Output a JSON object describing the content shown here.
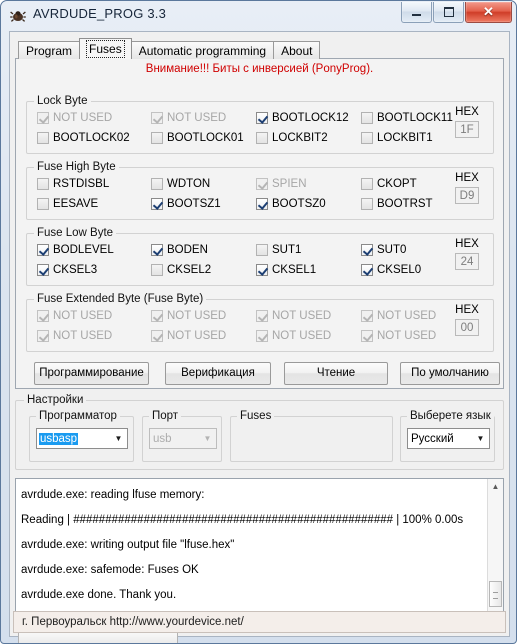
{
  "window": {
    "title": "AVRDUDE_PROG 3.3",
    "icon": "bug-icon",
    "minimize_label": "–",
    "maximize_label": "□",
    "close_label": "✕"
  },
  "tabs": [
    {
      "label": "Program",
      "active": false
    },
    {
      "label": "Fuses",
      "active": true
    },
    {
      "label": "Automatic programming",
      "active": false
    },
    {
      "label": "About",
      "active": false
    }
  ],
  "fuses_page": {
    "warning": "Внимание!!! Биты с инверсией (PonyProg).",
    "warning_color": "#d00000",
    "groups": [
      {
        "legend": "Lock Byte",
        "hex_label": "HEX",
        "hex_value": "1F",
        "bits": [
          {
            "label": "NOT USED",
            "state": "disabled-checked"
          },
          {
            "label": "NOT USED",
            "state": "disabled-checked"
          },
          {
            "label": "BOOTLOCK12",
            "state": "checked"
          },
          {
            "label": "BOOTLOCK11",
            "state": "unchecked"
          },
          {
            "label": "BOOTLOCK02",
            "state": "unchecked"
          },
          {
            "label": "BOOTLOCK01",
            "state": "unchecked"
          },
          {
            "label": "LOCKBIT2",
            "state": "unchecked"
          },
          {
            "label": "LOCKBIT1",
            "state": "unchecked"
          }
        ]
      },
      {
        "legend": "Fuse High Byte",
        "hex_label": "HEX",
        "hex_value": "D9",
        "bits": [
          {
            "label": "RSTDISBL",
            "state": "unchecked"
          },
          {
            "label": "WDTON",
            "state": "unchecked"
          },
          {
            "label": "SPIEN",
            "state": "disabled-checked"
          },
          {
            "label": "CKOPT",
            "state": "unchecked"
          },
          {
            "label": "EESAVE",
            "state": "unchecked"
          },
          {
            "label": "BOOTSZ1",
            "state": "checked"
          },
          {
            "label": "BOOTSZ0",
            "state": "checked"
          },
          {
            "label": "BOOTRST",
            "state": "unchecked"
          }
        ]
      },
      {
        "legend": "Fuse Low Byte",
        "hex_label": "HEX",
        "hex_value": "24",
        "bits": [
          {
            "label": "BODLEVEL",
            "state": "checked"
          },
          {
            "label": "BODEN",
            "state": "checked"
          },
          {
            "label": "SUT1",
            "state": "unchecked"
          },
          {
            "label": "SUT0",
            "state": "checked"
          },
          {
            "label": "CKSEL3",
            "state": "checked"
          },
          {
            "label": "CKSEL2",
            "state": "unchecked"
          },
          {
            "label": "CKSEL1",
            "state": "checked"
          },
          {
            "label": "CKSEL0",
            "state": "checked"
          }
        ]
      },
      {
        "legend": "Fuse Extended Byte (Fuse Byte)",
        "hex_label": "HEX",
        "hex_value": "00",
        "bits": [
          {
            "label": "NOT USED",
            "state": "disabled-checked"
          },
          {
            "label": "NOT USED",
            "state": "disabled-checked"
          },
          {
            "label": "NOT USED",
            "state": "disabled-checked"
          },
          {
            "label": "NOT USED",
            "state": "disabled-checked"
          },
          {
            "label": "NOT USED",
            "state": "disabled-checked"
          },
          {
            "label": "NOT USED",
            "state": "disabled-checked"
          },
          {
            "label": "NOT USED",
            "state": "disabled-checked"
          },
          {
            "label": "NOT USED",
            "state": "disabled-checked"
          }
        ]
      }
    ],
    "actions": [
      {
        "label": "Программирование"
      },
      {
        "label": "Верификация"
      },
      {
        "label": "Чтение"
      },
      {
        "label": "По умолчанию"
      }
    ]
  },
  "settings": {
    "legend": "Настройки",
    "programmer": {
      "legend": "Программатор",
      "value": "usbasp",
      "arrow": "▼"
    },
    "port": {
      "legend": "Порт",
      "value": "usb",
      "arrow": "▼"
    },
    "fuses": {
      "legend": "Fuses",
      "value": ""
    },
    "language": {
      "legend": "Выберете язык",
      "value": "Русский",
      "arrow": "▼"
    }
  },
  "log": {
    "lines": [
      "avrdude.exe: reading lfuse memory:",
      "Reading | ################################################## | 100% 0.00s",
      "avrdude.exe: writing output file \"lfuse.hex\"",
      "avrdude.exe: safemode: Fuses OK",
      "avrdude.exe done.  Thank you."
    ],
    "scroll_up": "▲",
    "scroll_down": "▼"
  },
  "statusbar": {
    "text": "г. Первоуральск   http://www.yourdevice.net/"
  }
}
